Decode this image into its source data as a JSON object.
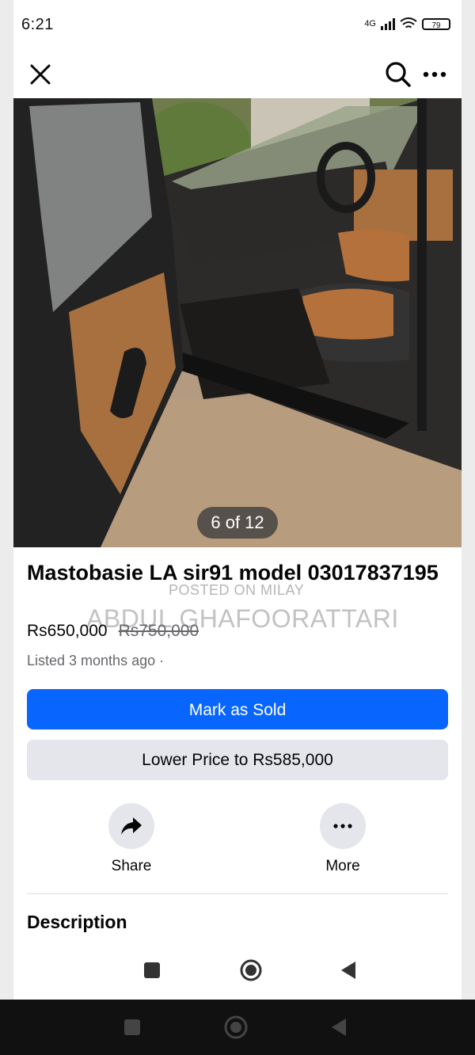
{
  "status_bar": {
    "time": "6:21",
    "network_label": "4G",
    "battery_label": "79"
  },
  "top_bar": {
    "close_icon": "close-icon",
    "search_icon": "search-icon",
    "more_icon": "more-dots-icon"
  },
  "photo": {
    "counter": "6 of 12"
  },
  "listing": {
    "title": "Mastobasie LA sir91 model 03017837195",
    "price": "Rs650,000",
    "original_price": "Rs750,000",
    "listed": "Listed 3 months ago ·"
  },
  "watermark": {
    "line1": "POSTED ON MILAY",
    "line2": "ABDUL GHAFOORATTARI"
  },
  "buttons": {
    "mark_sold": "Mark as Sold",
    "lower_price": "Lower Price to Rs585,000"
  },
  "actions": {
    "share_label": "Share",
    "more_label": "More"
  },
  "description": {
    "heading": "Description"
  },
  "colors": {
    "primary": "#0866ff",
    "secondary_bg": "#e4e6eb"
  }
}
